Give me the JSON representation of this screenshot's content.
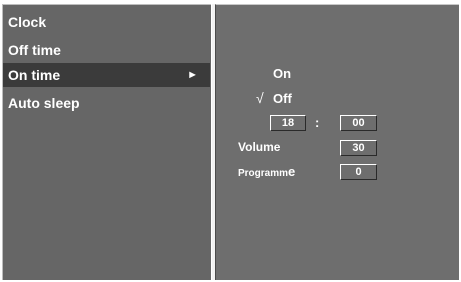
{
  "menu": {
    "items": [
      {
        "label": "Clock"
      },
      {
        "label": "Off time"
      },
      {
        "label": "On time",
        "arrow": "►"
      },
      {
        "label": "Auto sleep"
      }
    ]
  },
  "submenu": {
    "on_label": "On",
    "check_mark": "√",
    "off_label": "Off",
    "hour_value": "18",
    "time_separator": ":",
    "minute_value": "00",
    "volume_label": "Volume",
    "volume_value": "30",
    "programme_prefix": "Programm",
    "programme_suffix": "e",
    "programme_value": "0"
  }
}
